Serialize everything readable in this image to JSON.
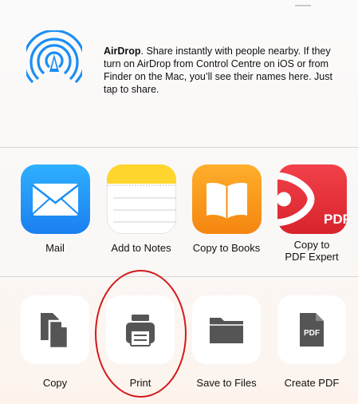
{
  "airdrop": {
    "title": "AirDrop",
    "description": ". Share instantly with people nearby. If they turn on AirDrop from Control Centre on iOS or from Finder on the Mac, you’ll see their names here. Just tap to share."
  },
  "apps": [
    {
      "label": "Mail",
      "icon": "mail-icon",
      "color": "#1a8ef5"
    },
    {
      "label": "Add to Notes",
      "icon": "notes-icon",
      "color": "#ffd52e"
    },
    {
      "label": "Copy to Books",
      "icon": "books-icon",
      "color": "#f59a12"
    },
    {
      "label": "Copy to\nPDF Expert",
      "icon": "pdf-expert-icon",
      "color": "#e8323a"
    }
  ],
  "actions": [
    {
      "label": "Copy",
      "icon": "copy-icon"
    },
    {
      "label": "Print",
      "icon": "printer-icon"
    },
    {
      "label": "Save to Files",
      "icon": "folder-icon"
    },
    {
      "label": "Create PDF",
      "icon": "pdf-document-icon",
      "badge": "PDF"
    }
  ],
  "pdf_expert_badge": "PDF",
  "colors": {
    "accent": "#1a8ef5",
    "annotation": "#d3191c",
    "glyph": "#555555"
  }
}
